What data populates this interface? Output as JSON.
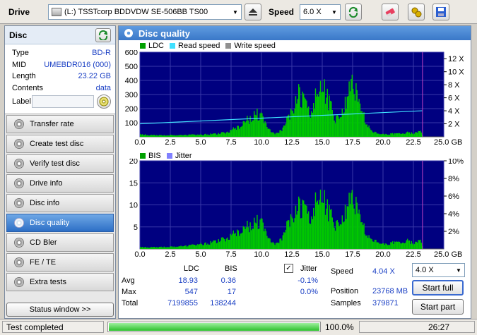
{
  "toolbar": {
    "drive_label": "Drive",
    "drive_value": "(L:)   TSSTcorp BDDVDW SE-506BB TS00",
    "speed_label": "Speed",
    "speed_value": "6.0 X"
  },
  "disc": {
    "header": "Disc",
    "rows": [
      {
        "label": "Type",
        "value": "BD-R"
      },
      {
        "label": "MID",
        "value": "UMEBDR016 (000)"
      },
      {
        "label": "Length",
        "value": "23.22 GB"
      },
      {
        "label": "Contents",
        "value": "data"
      },
      {
        "label": "Label",
        "value": ""
      }
    ]
  },
  "nav": {
    "items": [
      "Transfer rate",
      "Create test disc",
      "Verify test disc",
      "Drive info",
      "Disc info",
      "Disc quality",
      "CD Bler",
      "FE / TE",
      "Extra tests"
    ],
    "active_index": 5,
    "status_window": "Status window >>"
  },
  "main": {
    "title": "Disc quality",
    "chart1_legend": {
      "ldc": "LDC",
      "read": "Read speed",
      "write": "Write speed"
    },
    "chart2_legend": {
      "bis": "BIS",
      "jitter": "Jitter"
    },
    "colors": {
      "ldc": "#00c800",
      "read": "#40e0ff",
      "write": "#909090",
      "bis": "#00c800",
      "jitter": "#8080ff",
      "plot_bg": "#000080"
    }
  },
  "chart_data": [
    {
      "type": "area",
      "x_ticks": [
        "0.0",
        "2.5",
        "5.0",
        "7.5",
        "10.0",
        "12.5",
        "15.0",
        "17.5",
        "20.0",
        "22.5",
        "25.0 GB"
      ],
      "y_ticks_left": [
        "100",
        "200",
        "300",
        "400",
        "500",
        "600"
      ],
      "y_ticks_right": [
        "2 X",
        "4 X",
        "6 X",
        "8 X",
        "10 X",
        "12 X"
      ],
      "xlim": [
        0,
        25
      ],
      "ylim": [
        0,
        600
      ],
      "y2lim": [
        0,
        13
      ],
      "series": [
        {
          "name": "LDC",
          "x": [
            0.0,
            0.5,
            1.0,
            1.5,
            2.0,
            2.5,
            3.0,
            3.5,
            4.0,
            4.5,
            5.0,
            5.5,
            6.0,
            6.5,
            7.0,
            7.5,
            8.0,
            8.5,
            9.0,
            9.5,
            10.0,
            10.5,
            11.0,
            11.5,
            12.0,
            12.5,
            13.0,
            13.5,
            14.0,
            14.5,
            15.0,
            15.5,
            16.0,
            16.5,
            17.0,
            17.5,
            18.0,
            18.5,
            19.0,
            19.5,
            20.0,
            20.5,
            21.0,
            21.5,
            22.0,
            22.5,
            23.0,
            23.22
          ],
          "values": [
            20,
            18,
            15,
            14,
            14,
            15,
            15,
            16,
            18,
            20,
            20,
            22,
            25,
            30,
            40,
            60,
            90,
            130,
            170,
            210,
            170,
            70,
            30,
            50,
            130,
            260,
            380,
            300,
            240,
            380,
            460,
            330,
            160,
            200,
            380,
            470,
            300,
            150,
            50,
            30,
            25,
            25,
            30,
            25,
            40,
            30,
            50,
            20
          ]
        },
        {
          "name": "Read speed",
          "x": [
            0,
            23.22
          ],
          "values": [
            2.0,
            4.0
          ]
        }
      ]
    },
    {
      "type": "area",
      "x_ticks": [
        "0.0",
        "2.5",
        "5.0",
        "7.5",
        "10.0",
        "12.5",
        "15.0",
        "17.5",
        "20.0",
        "22.5",
        "25.0 GB"
      ],
      "y_ticks_left": [
        "5",
        "10",
        "15",
        "20"
      ],
      "y_ticks_right": [
        "2%",
        "4%",
        "6%",
        "8%",
        "10%"
      ],
      "xlim": [
        0,
        25
      ],
      "ylim": [
        0,
        20
      ],
      "y2lim": [
        0,
        10
      ],
      "series": [
        {
          "name": "BIS",
          "x": [
            0.0,
            0.5,
            1.0,
            1.5,
            2.0,
            2.5,
            3.0,
            3.5,
            4.0,
            4.5,
            5.0,
            5.5,
            6.0,
            6.5,
            7.0,
            7.5,
            8.0,
            8.5,
            9.0,
            9.5,
            10.0,
            10.5,
            11.0,
            11.5,
            12.0,
            12.5,
            13.0,
            13.5,
            14.0,
            14.5,
            15.0,
            15.5,
            16.0,
            16.5,
            17.0,
            17.5,
            18.0,
            18.5,
            19.0,
            19.5,
            20.0,
            20.5,
            21.0,
            21.5,
            22.0,
            22.5,
            23.0,
            23.22
          ],
          "values": [
            0.5,
            0.5,
            0.5,
            0.5,
            0.6,
            0.6,
            0.7,
            0.8,
            1.0,
            1.2,
            1.5,
            1.5,
            2.0,
            2.5,
            3.0,
            4.0,
            5.0,
            6.0,
            7.0,
            8.0,
            7.0,
            3.0,
            1.5,
            2.5,
            6.0,
            10.0,
            12.0,
            11.0,
            10.0,
            14.0,
            15.0,
            11.0,
            7.0,
            8.0,
            13.0,
            14.0,
            10.0,
            5.0,
            2.5,
            2.0,
            1.5,
            1.5,
            2.0,
            1.5,
            2.5,
            1.5,
            2.5,
            0.8
          ]
        }
      ]
    }
  ],
  "stats": {
    "col_ldc": "LDC",
    "col_bis": "BIS",
    "jitter_label": "Jitter",
    "jitter_checked": true,
    "rows": [
      {
        "label": "Avg",
        "ldc": "18.93",
        "bis": "0.36",
        "jitter": "-0.1%"
      },
      {
        "label": "Max",
        "ldc": "547",
        "bis": "17",
        "jitter": "0.0%"
      },
      {
        "label": "Total",
        "ldc": "7199855",
        "bis": "138244",
        "jitter": ""
      }
    ],
    "speed_label": "Speed",
    "speed_value": "4.04 X",
    "position_label": "Position",
    "position_value": "23768 MB",
    "samples_label": "Samples",
    "samples_value": "379871",
    "speed_select": "4.0 X",
    "start_full": "Start full",
    "start_part": "Start part"
  },
  "status": {
    "text": "Test completed",
    "progress": 1.0,
    "progress_text": "100.0%",
    "time": "26:27"
  }
}
